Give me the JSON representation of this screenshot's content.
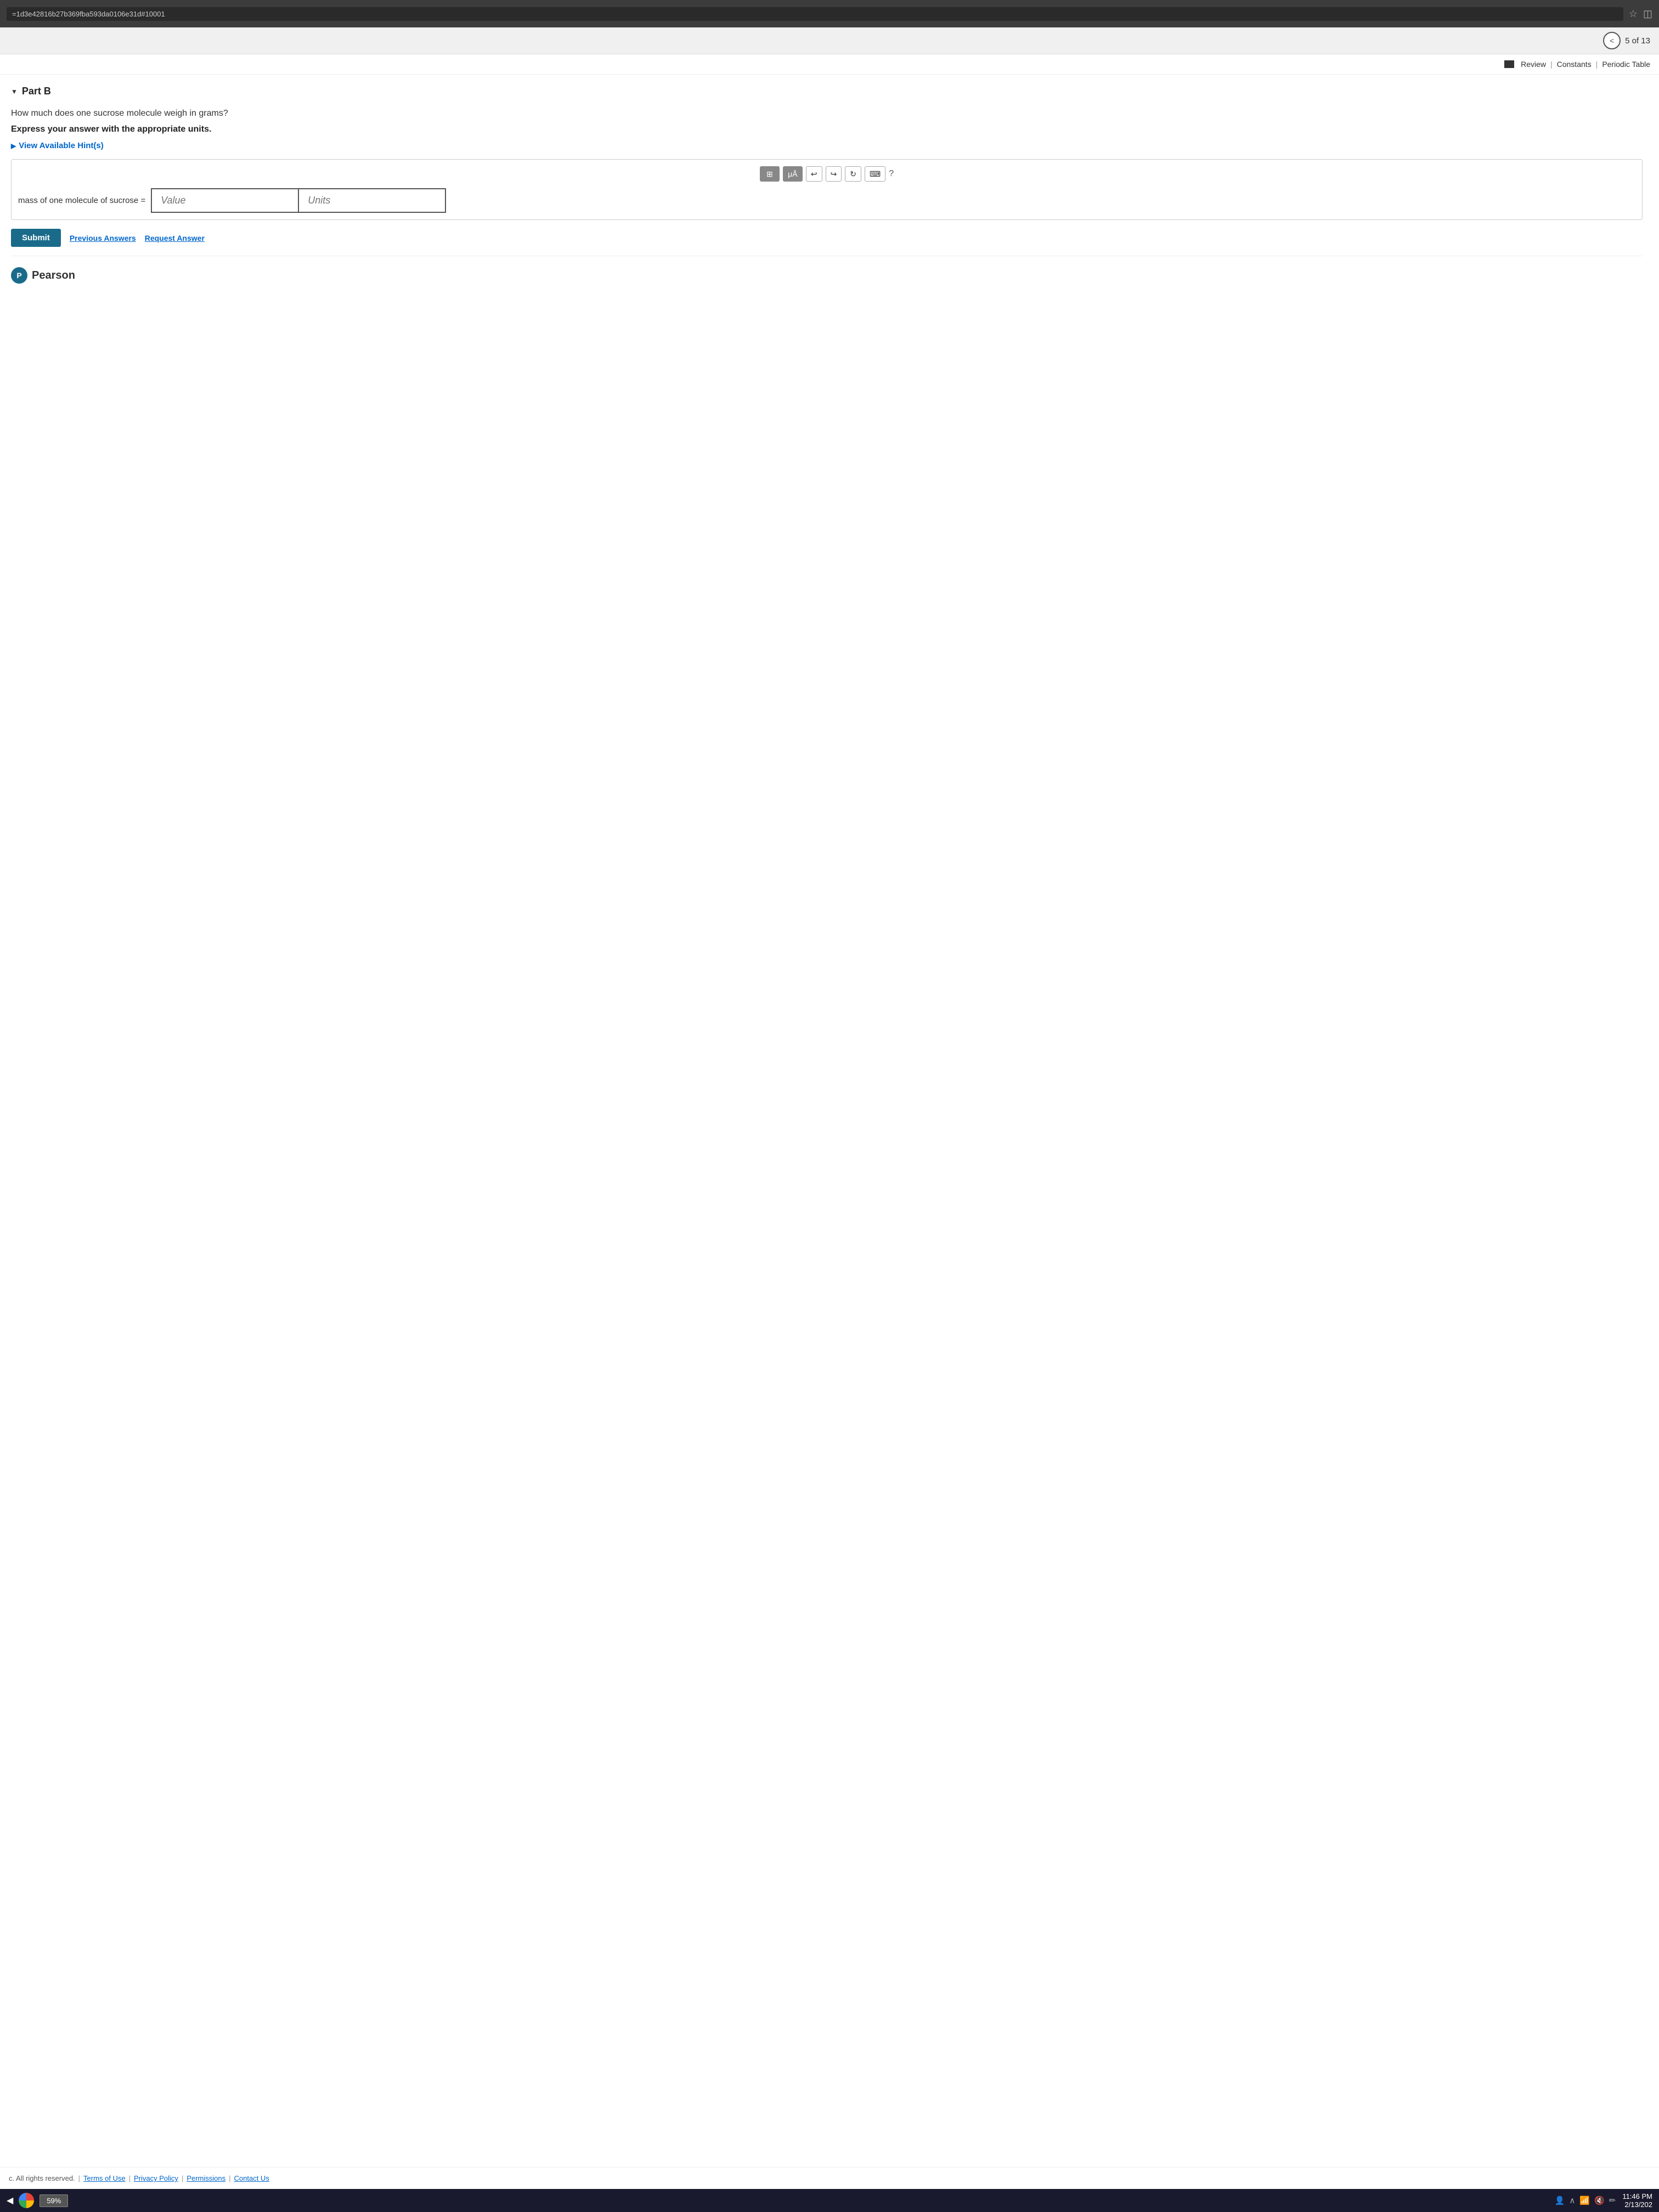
{
  "browser": {
    "address_bar_value": "=1d3e42816b27b369fba593da0106e31d#10001",
    "bookmark_icon": "☆",
    "tab_icon": "◫"
  },
  "pagination": {
    "prev_icon": "<",
    "current_text": "5 of 13"
  },
  "refbar": {
    "review_label": "Review",
    "constants_label": "Constants",
    "periodic_table_label": "Periodic Table",
    "separator": "|"
  },
  "question": {
    "part_label": "Part B",
    "question_text": "How much does one sucrose molecule weigh in grams?",
    "instruction_text": "Express your answer with the appropriate units.",
    "hint_label": "View Available Hint(s)",
    "collapse_arrow": "▼"
  },
  "answer_box": {
    "toolbar": {
      "matrix_icon": "⊞",
      "mu_label": "μÅ",
      "undo_icon": "↩",
      "redo_icon": "↪",
      "refresh_icon": "↻",
      "keyboard_icon": "⌨",
      "help_icon": "?"
    },
    "input_label": "mass of one molecule of sucrose =",
    "value_placeholder": "Value",
    "units_placeholder": "Units"
  },
  "actions": {
    "submit_label": "Submit",
    "prev_answers_label": "Previous Answers",
    "request_answer_label": "Request Answer"
  },
  "pearson": {
    "icon_letter": "P",
    "brand_name": "Pearson"
  },
  "footer": {
    "copyright_text": "c. All rights reserved.",
    "terms_label": "Terms of Use",
    "privacy_label": "Privacy Policy",
    "permissions_label": "Permissions",
    "contact_label": "Contact Us",
    "separator": "|"
  },
  "taskbar": {
    "battery_label": "59%",
    "time": "11:46 PM",
    "date": "2/13/202"
  }
}
